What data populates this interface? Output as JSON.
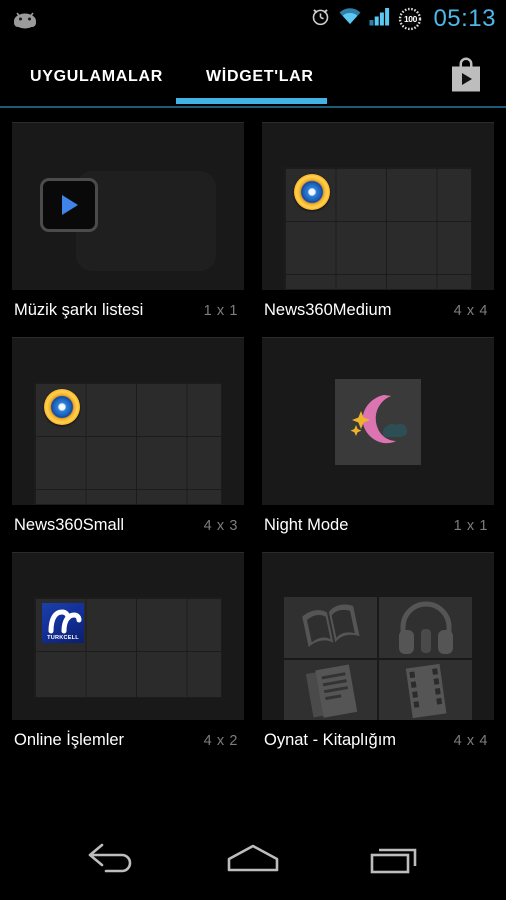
{
  "status_bar": {
    "notification_icon": "android-robot-icon",
    "alarm_icon": "alarm-clock-icon",
    "wifi_icon": "wifi-icon",
    "signal_icon": "signal-bars-icon",
    "battery_icon": "battery-circle-icon",
    "battery_level": "100",
    "time": "05:13"
  },
  "tabs": {
    "apps_label": "UYGULAMALAR",
    "widgets_label": "WİDGET'LAR",
    "active": "widgets",
    "accent_color": "#42b3e5",
    "store_icon": "play-store-bag-icon"
  },
  "widgets": [
    {
      "name": "Müzik şarkı listesi",
      "size": "1 x 1",
      "preview": "music-play-button-preview",
      "icon": "play-triangle-icon"
    },
    {
      "name": "News360Medium",
      "size": "4 x 4",
      "preview": "grid-preview",
      "icon": "news360-circle-icon"
    },
    {
      "name": "News360Small",
      "size": "4 x 3",
      "preview": "grid-preview",
      "icon": "news360-circle-icon"
    },
    {
      "name": "Night Mode",
      "size": "1 x 1",
      "preview": "night-mode-preview",
      "icon": "crescent-moon-stars-icon"
    },
    {
      "name": "Online İşlemler",
      "size": "4 x 2",
      "preview": "grid-preview",
      "icon": "turkcell-logo-icon",
      "icon_label": "TURKCELL"
    },
    {
      "name": "Oynat - Kitaplığım",
      "size": "4 x 4",
      "preview": "play-library-preview",
      "quadrant_icons": [
        "open-book-icon",
        "headphones-icon",
        "magazine-icon",
        "film-strip-icon"
      ]
    }
  ],
  "nav_bar": {
    "back_label": "back-icon",
    "home_label": "home-icon",
    "recents_label": "recents-icon"
  },
  "colors": {
    "background": "#000000",
    "tile_background": "#191919",
    "accent": "#42b3e5",
    "label_text": "#ffffff",
    "size_text": "#7d7d7d"
  }
}
